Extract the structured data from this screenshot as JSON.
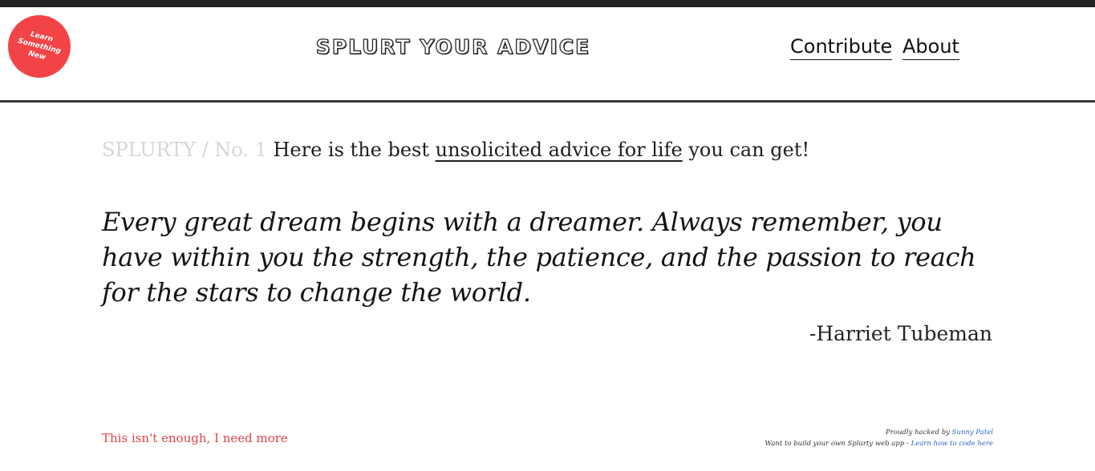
{
  "header": {
    "badge_text": "Learn Something New",
    "title": "SPLURT YOUR ADVICE",
    "nav": {
      "contribute": "Contribute",
      "about": "About"
    }
  },
  "headline": {
    "count_label": "SPLURTY / No. 1",
    "prefix": "Here is the best",
    "link_text": "unsolicited advice for life",
    "suffix": "you can get!"
  },
  "quote": {
    "text": "Every great dream begins with a dreamer. Always remember, you have within you the strength, the patience, and the passion to reach for the stars to change the world.",
    "author": "-Harriet Tubeman"
  },
  "footer": {
    "more_link": "This isn't enough, I need more",
    "credit_line1_prefix": "Proudly hacked by",
    "credit_author": "Sunny Patel",
    "credit_line2_prefix": "Want to build your own Splurty web app -",
    "credit_learn_link": "Learn how to code here"
  },
  "colors": {
    "badge": "#f24447",
    "more_link": "#e04448",
    "credit_link": "#2b63c9",
    "muted_count": "#d6d6d6",
    "header_rule": "#3a3438"
  }
}
